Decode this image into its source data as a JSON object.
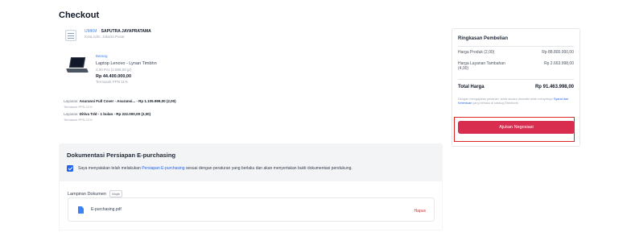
{
  "page": {
    "title": "Checkout"
  },
  "seller": {
    "badge": "UMKM",
    "name": "SAPUTRA JAYAPRATAMA",
    "location": "Kota Adm. Jakarta Pusat"
  },
  "product": {
    "tag": "Barang",
    "name": "Laptop Lenovo - Lynan Timbhn",
    "qty": "2,00 Pcs (2.888,00 gr)",
    "price": "Rp 44.400.000,00",
    "tax": "Termasuk PPN 11%"
  },
  "services": [
    {
      "prefix": "Layanan:",
      "name": "Asuransi Full Cover - Asuransi... - Rp 1.105.999,00 (2,00)",
      "tax": "Termasuk PPN 11%"
    },
    {
      "prefix": "Layanan:",
      "name": "Ditiva Tdd - 1 bulan - Rp 222.000,00 (2,00)",
      "tax": "Termasuk PPN 11%"
    }
  ],
  "documentation": {
    "title": "Dokumentasi Persiapan E-purchasing",
    "checkbox_checked": true,
    "statement_before": "Saya menyatakan telah melakukan",
    "statement_link": "Persiapan E-purchasing",
    "statement_after": "sesuai dengan peraturan yang berlaku dan akan menyertakan bukti dokumentasi pendukung.",
    "attachment_label": "Lampiran Dokumen",
    "required_badge": "Wajib",
    "file_name": "E-purchasing.pdf",
    "delete_label": "Hapus"
  },
  "summary": {
    "title": "Ringkasan Pembelian",
    "product_label": "Harga Produk (2,00)",
    "product_value": "Rp 88.800.000,00",
    "service_label": "Harga Layanan Tambahan (4,00)",
    "service_value": "Rp 2.663.998,00",
    "total_label": "Total Harga",
    "total_value": "Rp 91.463.998,00",
    "note_before": "Dengan mengajukan pesanan, anda secara otomatis telah menyetujui",
    "note_link": "Syarat dan Ketentuan",
    "note_after": "yang berlaku di katalog Elektronik",
    "submit_label": "Ajukan Negosiasi"
  },
  "colors": {
    "accent": "#2563eb",
    "submit": "#d92d4f",
    "highlight": "#dc2626"
  }
}
